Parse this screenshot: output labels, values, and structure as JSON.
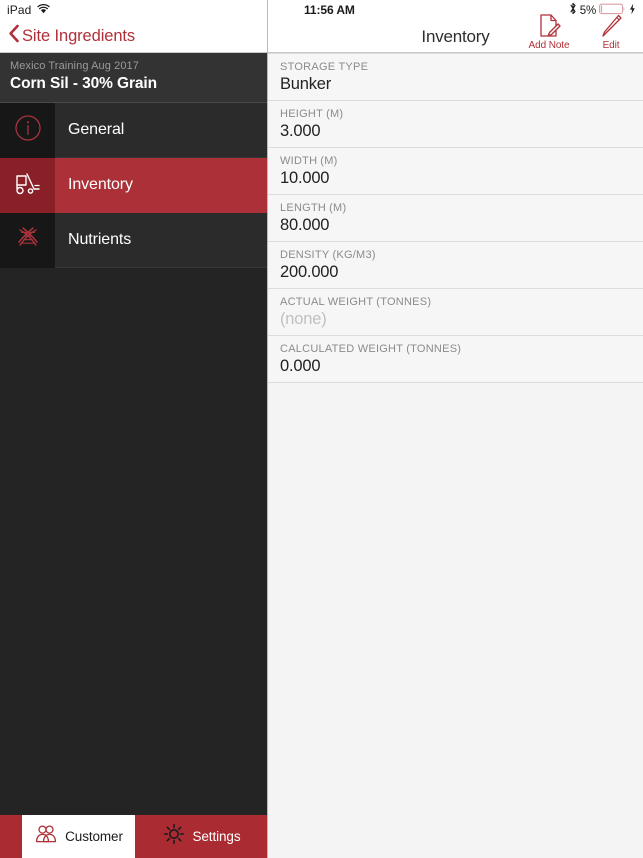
{
  "status_bar": {
    "device_label": "iPad",
    "wifi_icon": "wifi-icon",
    "time": "11:56 AM",
    "bluetooth_icon": "bluetooth-icon",
    "battery_percent": "5%",
    "battery_icon": "battery-icon",
    "charging_icon": "charging-bolt-icon"
  },
  "left_nav": {
    "back_icon": "chevron-left-icon",
    "back_label": "Site Ingredients"
  },
  "item_header": {
    "subtitle": "Mexico Training Aug 2017",
    "title": "Corn Sil - 30% Grain"
  },
  "sections": [
    {
      "label": "General",
      "icon": "info-circle-icon",
      "selected": false
    },
    {
      "label": "Inventory",
      "icon": "forklift-icon",
      "selected": true
    },
    {
      "label": "Nutrients",
      "icon": "dna-helix-icon",
      "selected": false
    }
  ],
  "tabbar": [
    {
      "label": "Customer",
      "icon": "people-icon",
      "active": true
    },
    {
      "label": "Settings",
      "icon": "gear-icon",
      "active": false
    }
  ],
  "right_nav": {
    "title": "Inventory",
    "actions": [
      {
        "label": "Add Note",
        "icon": "page-pencil-icon"
      },
      {
        "label": "Edit",
        "icon": "pencil-icon"
      }
    ]
  },
  "detail_fields": [
    {
      "label": "STORAGE TYPE",
      "unit": "",
      "value": "Bunker",
      "empty": false
    },
    {
      "label": "HEIGHT",
      "unit": "(M)",
      "value": "3.000",
      "empty": false
    },
    {
      "label": "WIDTH",
      "unit": "(M)",
      "value": "10.000",
      "empty": false
    },
    {
      "label": "LENGTH",
      "unit": "(M)",
      "value": "80.000",
      "empty": false
    },
    {
      "label": "DENSITY",
      "unit": "(KG/M3)",
      "value": "200.000",
      "empty": false
    },
    {
      "label": "ACTUAL WEIGHT",
      "unit": "(TONNES)",
      "value": "(none)",
      "empty": true
    },
    {
      "label": "CALCULATED WEIGHT",
      "unit": "(TONNES)",
      "value": "0.000",
      "empty": false
    }
  ],
  "colors": {
    "brand_red": "#ab2b33",
    "selected_red": "#ab3038",
    "selected_icon_red": "#8a2027",
    "sidebar_dark": "#242424",
    "sidebar_row_dark": "#2b2b2b",
    "sidebar_icon_dark": "#171717",
    "detail_bg": "#f4f4f4",
    "link_red": "#b03038"
  }
}
